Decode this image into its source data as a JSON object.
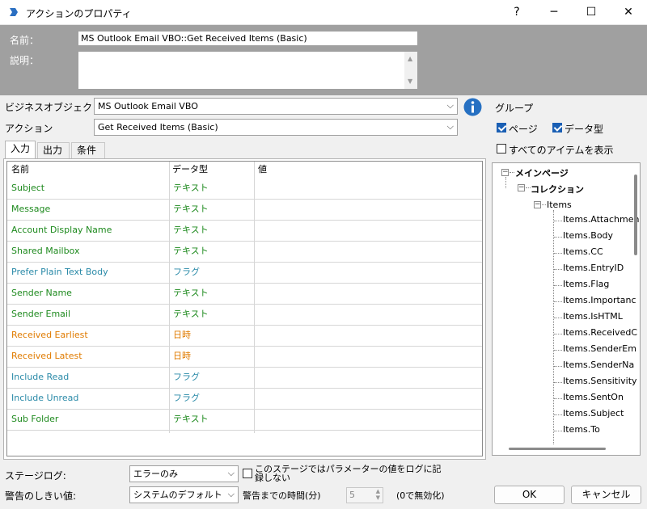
{
  "window": {
    "title": "アクションのプロパティ",
    "help": "?",
    "minimize": "─",
    "maximize": "☐",
    "close": "✕"
  },
  "header": {
    "name_label": "名前：",
    "name_value": "MS Outlook Email VBO::Get Received Items (Basic)",
    "desc_label": "説明："
  },
  "business_object": {
    "label": "ビジネスオブジェクト",
    "value": "MS Outlook Email VBO"
  },
  "action": {
    "label": "アクション",
    "value": "Get Received Items (Basic)"
  },
  "tabs": [
    "入力",
    "出力",
    "条件"
  ],
  "table": {
    "headers": [
      "名前",
      "データ型",
      "値"
    ],
    "rows": [
      {
        "name": "Subject",
        "type": "テキスト",
        "color": "#1e8a1e"
      },
      {
        "name": "Message",
        "type": "テキスト",
        "color": "#1e8a1e"
      },
      {
        "name": "Account Display Name",
        "type": "テキスト",
        "color": "#1e8a1e"
      },
      {
        "name": "Shared Mailbox",
        "type": "テキスト",
        "color": "#1e8a1e"
      },
      {
        "name": "Prefer Plain Text Body",
        "type": "フラグ",
        "color": "#2a8aa8"
      },
      {
        "name": "Sender Name",
        "type": "テキスト",
        "color": "#1e8a1e"
      },
      {
        "name": "Sender Email",
        "type": "テキスト",
        "color": "#1e8a1e"
      },
      {
        "name": "Received Earliest",
        "type": "日時",
        "color": "#e07b00"
      },
      {
        "name": "Received Latest",
        "type": "日時",
        "color": "#e07b00"
      },
      {
        "name": "Include Read",
        "type": "フラグ",
        "color": "#2a8aa8"
      },
      {
        "name": "Include Unread",
        "type": "フラグ",
        "color": "#2a8aa8"
      },
      {
        "name": "Sub Folder",
        "type": "テキスト",
        "color": "#1e8a1e"
      }
    ]
  },
  "group": {
    "label": "グループ",
    "page_label": "ページ",
    "page_checked": true,
    "datatype_label": "データ型",
    "datatype_checked": true,
    "show_all_label": "すべてのアイテムを表示",
    "show_all_checked": false
  },
  "tree": {
    "root": "メインページ",
    "collection": "コレクション",
    "items_label": "Items",
    "fields": [
      "Items.Attachmen",
      "Items.Body",
      "Items.CC",
      "Items.EntryID",
      "Items.Flag",
      "Items.Importanc",
      "Items.IsHTML",
      "Items.ReceivedC",
      "Items.SenderEm",
      "Items.SenderNa",
      "Items.Sensitivity",
      "Items.SentOn",
      "Items.Subject",
      "Items.To"
    ]
  },
  "footer": {
    "stage_log_label": "ステージログ:",
    "stage_log_value": "エラーのみ",
    "log_params_label": "このステージではパラメーターの値をログに記録しない",
    "log_params_checked": false,
    "warn_label": "警告のしきい値:",
    "warn_value": "システムのデフォルト",
    "warn_time_label": "警告までの時間(分)",
    "warn_time_value": "5",
    "disable_hint": "(0で無効化)",
    "ok": "OK",
    "cancel": "キャンセル"
  },
  "colors": {
    "text_green": "#1e8a1e",
    "flag_teal": "#2a8aa8",
    "date_orange": "#e07b00",
    "accent_blue": "#1a5fb4"
  }
}
